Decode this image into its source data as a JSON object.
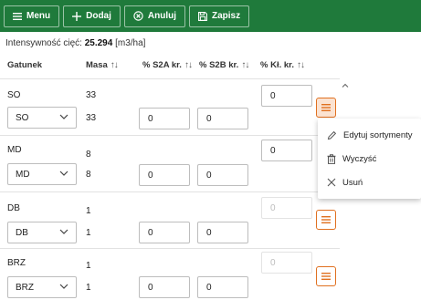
{
  "toolbar": {
    "buttons": [
      {
        "label": "Menu",
        "icon": "hamburger-icon"
      },
      {
        "label": "Dodaj",
        "icon": "plus-icon"
      },
      {
        "label": "Anuluj",
        "icon": "cancel-circle-icon"
      },
      {
        "label": "Zapisz",
        "icon": "save-icon"
      }
    ],
    "background": "#1f7a3b"
  },
  "intensity": {
    "label": "Intensywność cięć:",
    "value": "25.294",
    "unit": "[m3/ha]"
  },
  "columns": [
    "Gatunek",
    "Masa",
    "% S2A kr.",
    "% S2B kr.",
    "% Kł. kr."
  ],
  "sort_glyph": "↑↓",
  "rows": [
    {
      "code": "SO",
      "mass": "33",
      "select_value": "SO",
      "mass2": "33",
      "s2a": "0",
      "s2b": "0",
      "kl": "0",
      "kl_disabled": false
    },
    {
      "code": "MD",
      "mass": "8",
      "select_value": "MD",
      "mass2": "8",
      "s2a": "0",
      "s2b": "0",
      "kl": "0",
      "kl_disabled": false
    },
    {
      "code": "DB",
      "mass": "1",
      "select_value": "DB",
      "mass2": "1",
      "s2a": "0",
      "s2b": "0",
      "kl": "0",
      "kl_disabled": true
    },
    {
      "code": "BRZ",
      "mass": "1",
      "select_value": "BRZ",
      "mass2": "1",
      "s2a": "0",
      "s2b": "0",
      "kl": "0",
      "kl_disabled": true
    }
  ],
  "context_menu": {
    "items": [
      {
        "label": "Edytuj sortymenty",
        "icon": "pencil-icon"
      },
      {
        "label": "Wyczyść",
        "icon": "trash-icon"
      },
      {
        "label": "Usuń",
        "icon": "close-icon"
      }
    ]
  },
  "colors": {
    "accent": "#e07020",
    "active_menu_bg": "#fbe3d2"
  }
}
